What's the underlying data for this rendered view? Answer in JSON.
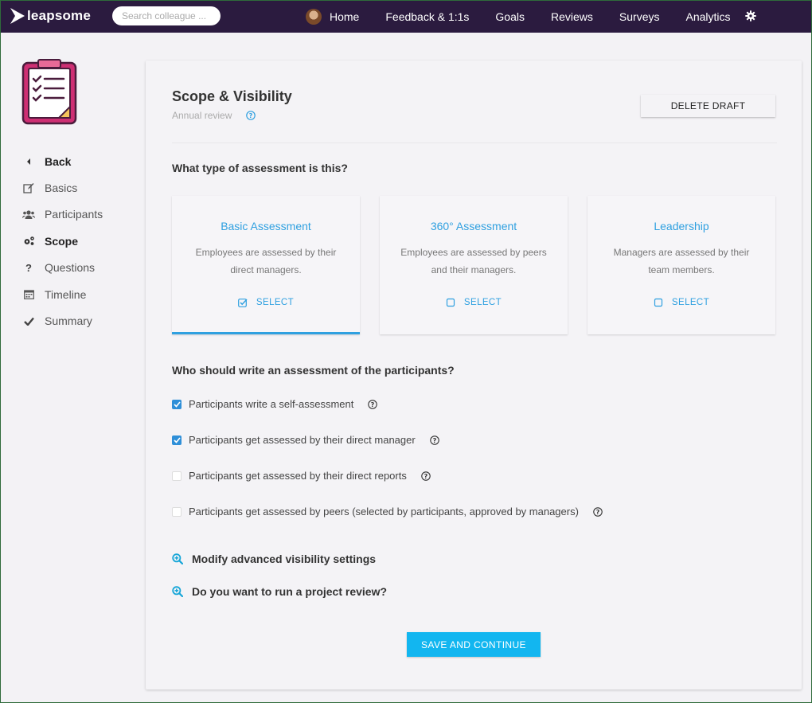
{
  "brand": {
    "name": "leapsome"
  },
  "search": {
    "placeholder": "Search colleague ..."
  },
  "nav": {
    "items": [
      {
        "label": "Home"
      },
      {
        "label": "Feedback & 1:1s"
      },
      {
        "label": "Goals"
      },
      {
        "label": "Reviews"
      },
      {
        "label": "Surveys"
      },
      {
        "label": "Analytics"
      }
    ]
  },
  "sidebar": {
    "items": [
      {
        "label": "Back",
        "icon": "caret-left-icon"
      },
      {
        "label": "Basics",
        "icon": "edit-icon"
      },
      {
        "label": "Participants",
        "icon": "users-icon"
      },
      {
        "label": "Scope",
        "icon": "cogs-icon"
      },
      {
        "label": "Questions",
        "icon": "question-icon"
      },
      {
        "label": "Timeline",
        "icon": "calendar-icon"
      },
      {
        "label": "Summary",
        "icon": "check-icon"
      }
    ]
  },
  "header": {
    "title": "Scope & Visibility",
    "subtitle": "Annual review",
    "delete_label": "DELETE DRAFT"
  },
  "assessment": {
    "question": "What type of assessment is this?",
    "options": [
      {
        "title": "Basic Assessment",
        "description": "Employees are assessed by their direct managers.",
        "select_label": "SELECT",
        "selected": true
      },
      {
        "title": "360° Assessment",
        "description": "Employees are assessed by peers and their managers.",
        "select_label": "SELECT",
        "selected": false
      },
      {
        "title": "Leadership",
        "description": "Managers are assessed by their team members.",
        "select_label": "SELECT",
        "selected": false
      }
    ]
  },
  "writers": {
    "question": "Who should write an assessment of the participants?",
    "options": [
      {
        "label": "Participants write a self-assessment",
        "checked": true
      },
      {
        "label": "Participants get assessed by their direct manager",
        "checked": true
      },
      {
        "label": "Participants get assessed by their direct reports",
        "checked": false
      },
      {
        "label": "Participants get assessed by peers (selected by participants, approved by managers)",
        "checked": false
      }
    ]
  },
  "expanders": {
    "visibility": "Modify advanced visibility settings",
    "project": "Do you want to run a project review?"
  },
  "footer": {
    "save_label": "SAVE AND CONTINUE"
  },
  "colors": {
    "nav_bg": "#2b1b3f",
    "accent": "#2fa0e0",
    "button": "#12b6f0",
    "checkbox": "#2f8fd8"
  }
}
